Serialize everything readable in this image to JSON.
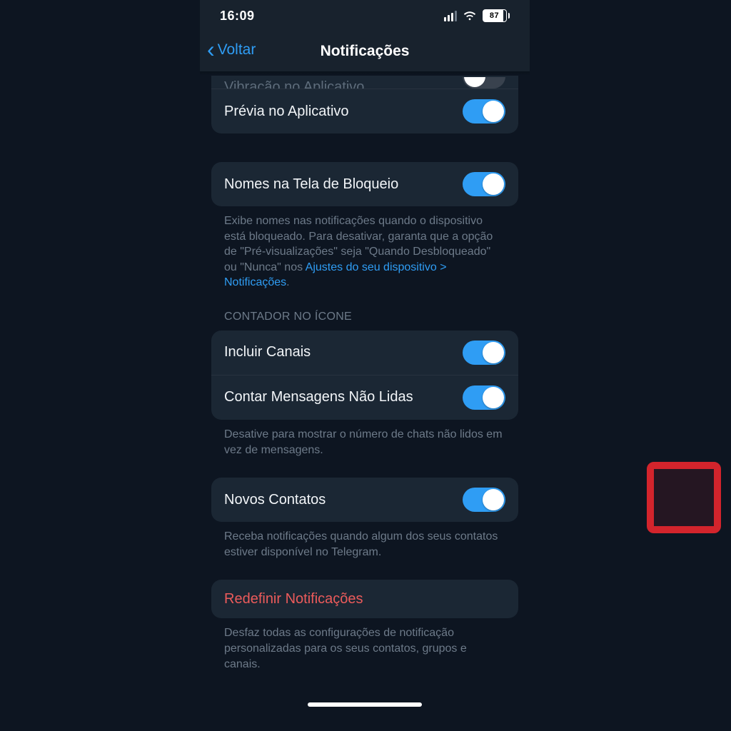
{
  "status": {
    "time": "16:09",
    "battery": "87"
  },
  "nav": {
    "back": "Voltar",
    "title": "Notificações"
  },
  "rows": {
    "clipped_label": "Vibração no Aplicativo",
    "previa": "Prévia no Aplicativo",
    "nomes_bloqueio": "Nomes na Tela de Bloqueio",
    "incluir_canais": "Incluir Canais",
    "contar_nao_lidas": "Contar Mensagens Não Lidas",
    "novos_contatos": "Novos Contatos",
    "redefinir": "Redefinir Notificações"
  },
  "footers": {
    "bloqueio_a": "Exibe nomes nas notificações quando o dispositivo está bloqueado. Para desativar, garanta que a opção de \"Pré-visualizações\" seja \"Quando Desbloqueado\" ou \"Nunca\" nos ",
    "bloqueio_link": "Ajustes do seu dispositivo > Notificações",
    "bloqueio_b": ".",
    "contador": "Desative para mostrar o número de chats não lidos em vez de mensagens.",
    "novos": "Receba notificações quando algum dos seus contatos estiver disponível no Telegram.",
    "redefinir": "Desfaz todas as configurações de notificação personalizadas para os seus contatos, grupos e canais."
  },
  "section_headers": {
    "contador": "CONTADOR NO ÍCONE"
  },
  "colors": {
    "accent": "#2f9df4",
    "danger": "#ec5b5b",
    "card": "#1b2734",
    "bg": "#0d1521",
    "highlight": "#d3242c"
  }
}
